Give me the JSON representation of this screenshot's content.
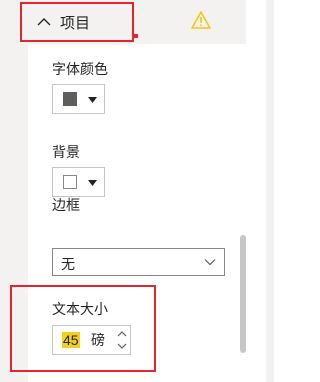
{
  "section": {
    "title": "项目",
    "collapse_icon": "chevron-up-icon",
    "warning_icon": "warning-icon"
  },
  "fields": {
    "font_color": {
      "label": "字体颜色",
      "swatch_color": "#605e5c"
    },
    "background": {
      "label": "背景",
      "swatch_color": "#ffffff"
    },
    "border": {
      "label": "边框",
      "value": "无"
    },
    "text_size": {
      "label": "文本大小",
      "value": "45",
      "unit": "磅"
    }
  },
  "colors": {
    "highlight": "#e3262d",
    "warning": "#f2c811",
    "selection": "#f2d11b",
    "panel_bg": "#f3f2f1"
  }
}
